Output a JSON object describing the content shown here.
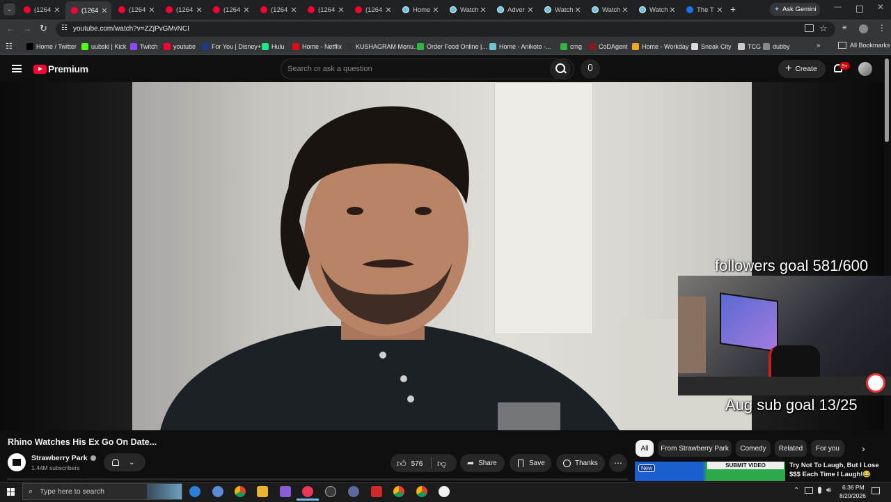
{
  "browser": {
    "tabs": [
      {
        "label": "(1264",
        "type": "yt"
      },
      {
        "label": "(1264",
        "type": "yt",
        "active": true
      },
      {
        "label": "(1264",
        "type": "yt"
      },
      {
        "label": "(1264",
        "type": "yt"
      },
      {
        "label": "(1264",
        "type": "yt"
      },
      {
        "label": "(1264",
        "type": "yt"
      },
      {
        "label": "(1264",
        "type": "yt"
      },
      {
        "label": "(1264",
        "type": "yt"
      },
      {
        "label": "Home",
        "type": "ani"
      },
      {
        "label": "Watch",
        "type": "ani"
      },
      {
        "label": "Adver",
        "type": "ani"
      },
      {
        "label": "Watch",
        "type": "ani"
      },
      {
        "label": "Watch",
        "type": "ani"
      },
      {
        "label": "Watch",
        "type": "ani"
      },
      {
        "label": "The T",
        "type": "blue"
      }
    ],
    "new_tab": "+",
    "ask_gemini": "Ask Gemini",
    "url": "youtube.com/watch?v=ZZjPvGMvNCI",
    "bookmarks": [
      {
        "label": "Home / Twitter",
        "color": "#000000"
      },
      {
        "label": "uubski | Kick",
        "color": "#53fc18"
      },
      {
        "label": "Twitch",
        "color": "#9146ff"
      },
      {
        "label": "youtube",
        "color": "#ff0033"
      },
      {
        "label": "For You | Disney+",
        "color": "#1a3a8a"
      },
      {
        "label": "Hulu",
        "color": "#1ce783"
      },
      {
        "label": "Home - Netflix",
        "color": "#e50914"
      },
      {
        "label": "KUSHAGRAM Menu...",
        "color": "#333333"
      },
      {
        "label": "Order Food Online |...",
        "color": "#2db742"
      },
      {
        "label": "Home - Anikoto -...",
        "color": "#6cc6d8"
      },
      {
        "label": "cmg",
        "color": "#2db742"
      },
      {
        "label": "CoDAgent",
        "color": "#8b1a1a"
      },
      {
        "label": "Home - Workday",
        "color": "#f5a623"
      },
      {
        "label": "Sneak City",
        "color": "#dddddd"
      },
      {
        "label": "TCG",
        "color": "#cccccc"
      },
      {
        "label": "dubby",
        "color": "#888888"
      }
    ],
    "all_bookmarks": "All Bookmarks"
  },
  "youtube": {
    "logo": "Premium",
    "search_placeholder": "Search or ask a question",
    "create": "Create",
    "notif_badge": "9+",
    "video_title": "Rhino Watches His Ex Go On Date...",
    "channel": "Strawberry Park",
    "subscribers": "1.44M subscribers",
    "likes": "576",
    "share": "Share",
    "save": "Save",
    "thanks": "Thanks",
    "chips": [
      "All",
      "From Strawberry Park",
      "Comedy",
      "Related",
      "For you"
    ],
    "rec": {
      "badge": "New",
      "thumb_text": "SUBMIT VIDEO",
      "title": "Try Not To Laugh, But I Lose $$$ Each Time I Laugh!😂"
    }
  },
  "stream_overlay": {
    "followers": "followers goal 581/600",
    "subs": "Aug sub goal 13/25"
  },
  "taskbar": {
    "search_placeholder": "Type here to search",
    "time": "6:36 PM",
    "date": "8/20/2026"
  }
}
